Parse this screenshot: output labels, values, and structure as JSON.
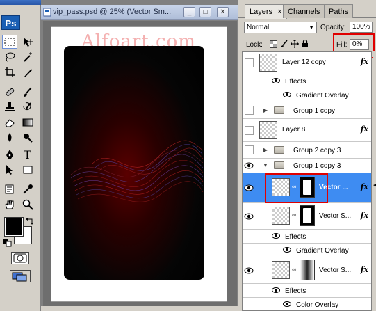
{
  "document": {
    "title": "vip_pass.psd @ 25% (Vector Sm...",
    "watermark": "Alfoart.com",
    "minimize_symbol": "_",
    "maximize_symbol": "□",
    "close_symbol": "✕"
  },
  "tools": {
    "logo": "Ps",
    "icons": [
      "marquee-icon",
      "move-icon",
      "lasso-icon",
      "magic-wand-icon",
      "crop-icon",
      "slice-icon",
      "healing-icon",
      "brush-icon",
      "stamp-icon",
      "history-brush-icon",
      "eraser-icon",
      "gradient-icon",
      "blur-icon",
      "dodge-icon",
      "pen-icon",
      "type-icon",
      "path-select-icon",
      "shape-icon",
      "notes-icon",
      "eyedropper-icon",
      "hand-icon",
      "zoom-icon"
    ],
    "foreground_color": "#000000",
    "background_color": "#ffffff"
  },
  "panel": {
    "tabs": [
      {
        "label": "Layers",
        "close": "×",
        "active": true
      },
      {
        "label": "Channels",
        "active": false
      },
      {
        "label": "Paths",
        "active": false
      }
    ],
    "blend_mode": "Normal",
    "opacity_label": "Opacity:",
    "opacity_value": "100%",
    "lock_label": "Lock:",
    "fill_label": "Fill:",
    "fill_value": "0%",
    "highlight_color": "#e00000",
    "selected_row_color": "#3e8cf2"
  },
  "layers": [
    {
      "name": "Layer 12 copy",
      "type": "layer",
      "fx": "fx",
      "visible": false
    },
    {
      "name": "Effects",
      "type": "effects-header"
    },
    {
      "name": "Gradient Overlay",
      "type": "effect"
    },
    {
      "name": "Group 1 copy",
      "type": "group",
      "visible": false
    },
    {
      "name": "Layer 8",
      "type": "layer",
      "fx": "fx",
      "visible": false
    },
    {
      "name": "Group 2 copy 3",
      "type": "group",
      "visible": false
    },
    {
      "name": "Group 1 copy 3",
      "type": "group-open",
      "visible": true
    },
    {
      "name": "Vector ...",
      "type": "vector-layer",
      "fx": "fx",
      "visible": true,
      "selected": true
    },
    {
      "name": "Vector S...",
      "type": "vector-layer",
      "fx": "fx",
      "visible": true
    },
    {
      "name": "Effects",
      "type": "effects-header"
    },
    {
      "name": "Gradient Overlay",
      "type": "effect"
    },
    {
      "name": "Vector S...",
      "type": "vector-layer-grad",
      "fx": "fx",
      "visible": true
    },
    {
      "name": "Effects",
      "type": "effects-header"
    },
    {
      "name": "Color Overlay",
      "type": "effect"
    }
  ]
}
